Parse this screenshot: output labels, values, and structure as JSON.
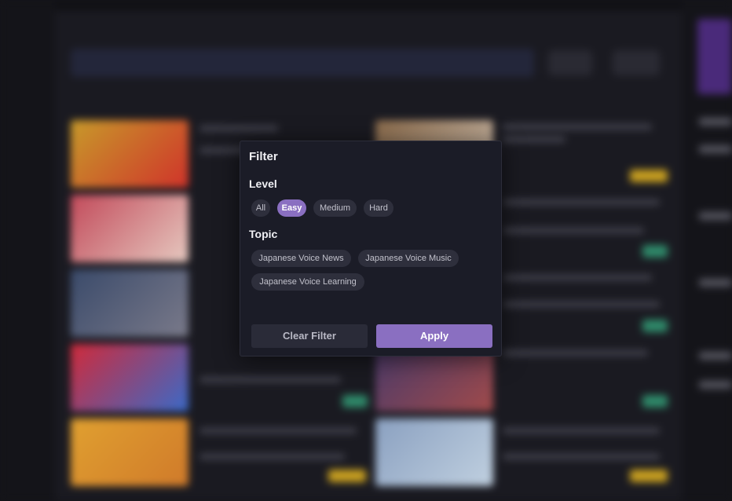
{
  "modal": {
    "title": "Filter",
    "level_label": "Level",
    "levels": [
      "All",
      "Easy",
      "Medium",
      "Hard"
    ],
    "selected_level": "Easy",
    "topic_label": "Topic",
    "topics": [
      "Japanese Voice News",
      "Japanese Voice Music",
      "Japanese Voice Learning"
    ],
    "clear_label": "Clear Filter",
    "apply_label": "Apply"
  },
  "colors": {
    "accent": "#8a6fc1",
    "modal_bg": "#1b1c27",
    "chip_bg": "#2e2f3c"
  }
}
